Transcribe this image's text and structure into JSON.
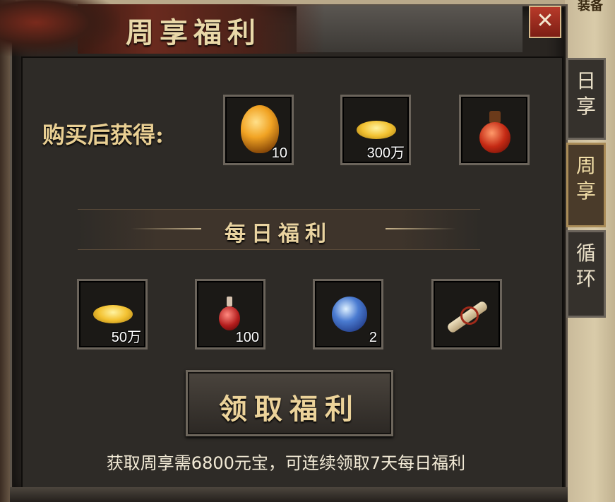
{
  "window": {
    "title": "周享福利",
    "close_symbol": "✕",
    "corner_label": "装备"
  },
  "purchase": {
    "label": "购买后获得:",
    "rewards": [
      {
        "icon": "golden-egg-icon",
        "count": "10"
      },
      {
        "icon": "gold-coins-icon",
        "count": "300万"
      },
      {
        "icon": "red-potion-jar-icon",
        "count": ""
      }
    ]
  },
  "daily": {
    "title": "每日福利",
    "rewards": [
      {
        "icon": "gold-coins-icon",
        "count": "50万"
      },
      {
        "icon": "red-potion-icon",
        "count": "100"
      },
      {
        "icon": "blue-orb-icon",
        "count": "2"
      },
      {
        "icon": "scroll-icon",
        "count": ""
      }
    ]
  },
  "claim_button": {
    "label": "领取福利"
  },
  "footer_note": "获取周享需6800元宝，可连续领取7天每日福利",
  "side_tabs": [
    {
      "label": [
        "日",
        "享"
      ],
      "active": false
    },
    {
      "label": [
        "周",
        "享"
      ],
      "active": true
    },
    {
      "label": [
        "循",
        "环"
      ],
      "active": false
    }
  ]
}
